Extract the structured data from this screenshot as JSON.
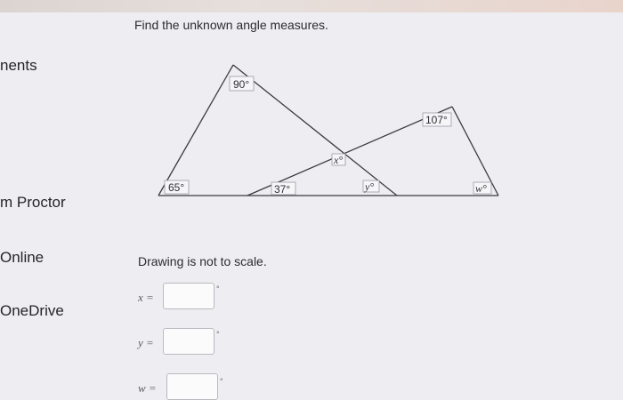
{
  "sidebar": {
    "items": [
      {
        "label": "nents"
      },
      {
        "label": "m Proctor"
      },
      {
        "label": "Online"
      },
      {
        "label": "OneDrive"
      }
    ]
  },
  "question": {
    "title": "Find the unknown angle measures.",
    "note": "Drawing is not to scale."
  },
  "figure": {
    "angles": {
      "top": "90°",
      "left": "65°",
      "base_mid": "37°",
      "right_upper": "107°",
      "x": "x°",
      "y": "y°",
      "w": "w°"
    }
  },
  "answers": [
    {
      "var": "x =",
      "value": "",
      "unit": "°"
    },
    {
      "var": "y =",
      "value": "",
      "unit": "°"
    },
    {
      "var": "w =",
      "value": "",
      "unit": "°"
    }
  ]
}
